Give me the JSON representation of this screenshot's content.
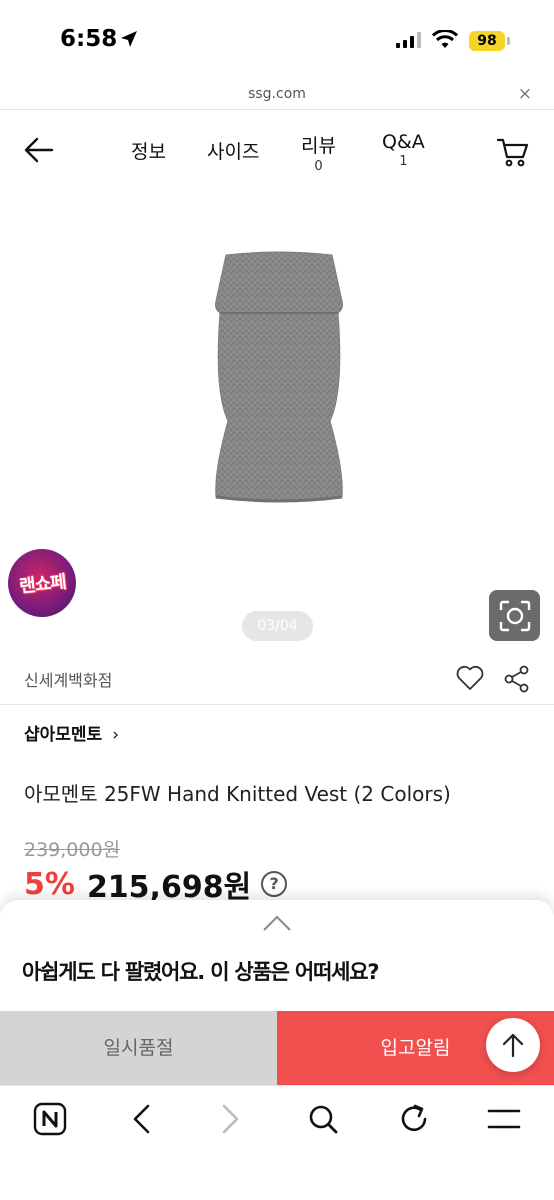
{
  "status_bar": {
    "time": "6:58",
    "battery": "98"
  },
  "browser": {
    "url": "ssg.com",
    "close_glyph": "×"
  },
  "nav": {
    "tabs": [
      {
        "label": "정보"
      },
      {
        "label": "사이즈"
      },
      {
        "label": "리뷰",
        "count": "0"
      },
      {
        "label": "Q&A",
        "count": "1"
      }
    ]
  },
  "gallery": {
    "pager": "03/04",
    "promo_badge": "랜쇼페"
  },
  "product": {
    "store": "신세계백화점",
    "brand": "샵아모멘토",
    "brand_chevron": "›",
    "title": "아모멘토 25FW Hand Knitted Vest (2 Colors)",
    "original_price": "239,000원",
    "discount": "5%",
    "price": "215,698원",
    "help_glyph": "?"
  },
  "sheet": {
    "message": "아쉽게도 다 팔렸어요. 이 상품은 어떠세요?"
  },
  "actions": {
    "sold_out_label": "일시품절",
    "notify_label": "입고알림"
  },
  "colors": {
    "accent": "#f24f4f",
    "discount": "#ef3f3f",
    "battery": "#f5d425",
    "disabled": "#d4d4d4"
  },
  "icons": {
    "nav": [
      "back-arrow-icon",
      "cart-icon"
    ],
    "toolbar": [
      "naver-icon",
      "browser-back-icon",
      "browser-forward-icon",
      "search-icon",
      "reload-icon",
      "menu-icon"
    ]
  }
}
